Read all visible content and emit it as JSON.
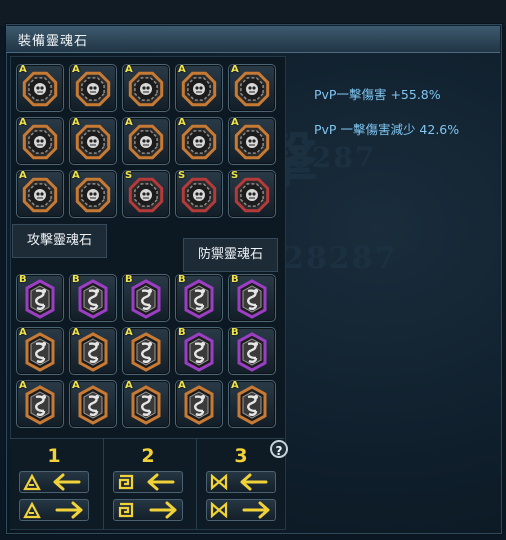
{
  "window": {
    "title": "裝備靈魂石"
  },
  "tabs": {
    "attack": "攻擊靈魂石",
    "defense": "防禦靈魂石"
  },
  "attack_grid": [
    [
      "A",
      "A",
      "A",
      "A",
      "A"
    ],
    [
      "A",
      "A",
      "A",
      "A",
      "A"
    ],
    [
      "A",
      "A",
      "S",
      "S",
      "S"
    ]
  ],
  "defense_grid": [
    [
      "B",
      "B",
      "B",
      "B",
      "B"
    ],
    [
      "A",
      "A",
      "A",
      "B",
      "B"
    ],
    [
      "A",
      "A",
      "A",
      "A",
      "A"
    ]
  ],
  "controls": [
    {
      "number": "1",
      "icon": "triangle-rune-icon"
    },
    {
      "number": "2",
      "icon": "spiral-rune-icon"
    },
    {
      "number": "3",
      "icon": "bowtie-rune-icon"
    }
  ],
  "help": "?",
  "stats": [
    "PvP一擊傷害 +55.8%",
    "PvP 一擊傷害減少 42.6%"
  ],
  "colors": {
    "grade_text": "#f0e24a",
    "grade_A_frame": "#c77a34",
    "grade_S_frame": "#b53a3a",
    "grade_B_frame": "#9b3ec4",
    "stat_text": "#7fc6f2",
    "number_gold": "#f1d238"
  }
}
